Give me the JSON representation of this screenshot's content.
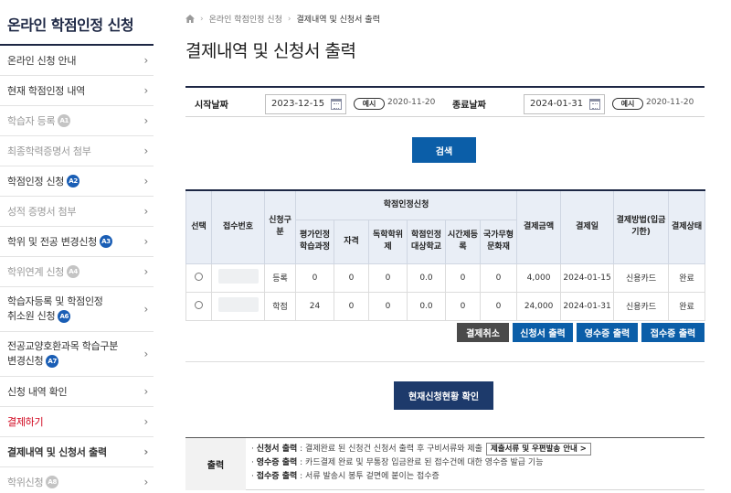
{
  "sidebar": {
    "title": "온라인 학점인정 신청",
    "items": [
      {
        "label": "온라인 신청 안내",
        "badge": ""
      },
      {
        "label": "현재 학점인정 내역",
        "badge": ""
      },
      {
        "label": "학습자 등록",
        "badge": "A1"
      },
      {
        "label": "최종학력증명서 첨부",
        "badge": ""
      },
      {
        "label": "학점인정 신청",
        "badge": "A2"
      },
      {
        "label": "성적 증명서 첨부",
        "badge": ""
      },
      {
        "label": "학위 및 전공 변경신청",
        "badge": "A3"
      },
      {
        "label": "학위연계 신청",
        "badge": "A4"
      },
      {
        "label_line1": "학습자등록 및 학점인정",
        "label_line2": "취소원 신청",
        "badge": "A6"
      },
      {
        "label_line1": "전공교양호환과목 학습구분",
        "label_line2": "변경신청",
        "badge": "A7"
      },
      {
        "label": "신청 내역 확인",
        "badge": ""
      },
      {
        "label": "결제하기",
        "badge": ""
      },
      {
        "label": "결제내역 및 신청서 출력",
        "badge": ""
      },
      {
        "label": "학위신청",
        "badge": "A8"
      }
    ]
  },
  "breadcrumb": {
    "home_icon": "home-icon",
    "level1": "온라인 학점인정 신청",
    "level2": "결제내역 및 신청서 출력"
  },
  "page_title": "결제내역 및 신청서 출력",
  "filter": {
    "start_label": "시작날짜",
    "start_value": "2023-12-15",
    "end_label": "종료날짜",
    "end_value": "2024-01-31",
    "example_label": "예시",
    "example_date": "2020-11-20",
    "search_button": "검색"
  },
  "table": {
    "headers": {
      "select": "선택",
      "receipt_no": "접수번호",
      "app_type": "신청구분",
      "credit_group": "학점인정신청",
      "sub": [
        "평가인정학습과정",
        "자격",
        "독학학위제",
        "학점인정대상학교",
        "시간제등록",
        "국가무형문화재"
      ],
      "amount": "결제금액",
      "pay_date": "결제일",
      "method": "결제방법(입금기한)",
      "status": "결제상태"
    },
    "rows": [
      {
        "type": "등록",
        "sub": [
          "0",
          "0",
          "0",
          "0.0",
          "0",
          "0"
        ],
        "amount": "4,000",
        "date": "2024-01-15",
        "method": "신용카드",
        "status": "완료"
      },
      {
        "type": "학점",
        "sub": [
          "24",
          "0",
          "0",
          "0.0",
          "0",
          "0"
        ],
        "amount": "24,000",
        "date": "2024-01-31",
        "method": "신용카드",
        "status": "완료"
      }
    ]
  },
  "actions": {
    "cancel": "결제취소",
    "print_application": "신청서 출력",
    "print_receipt": "영수증 출력",
    "print_acceptance": "접수증 출력",
    "status_check": "현재신청현황 확인"
  },
  "info": {
    "head": "출력",
    "line1_key": "신청서 출력",
    "line1_text": " : 결제완료 된 신청건 신청서 출력 후 구비서류와 제출",
    "guide_button": "제출서류 및 우편발송 안내 >",
    "line2_key": "영수증 출력",
    "line2_text": " : 카드결제 완료 및 무통장 입금완료 된 접수건에 대한 영수증 발급 기능",
    "line3_key": "접수증 출력",
    "line3_text": " : 서류 발송시 봉투 겉면에 붙이는 접수증"
  },
  "colors": {
    "navy": "#1d2744",
    "blue": "#0b5ea8",
    "active_red": "#d0021b",
    "header_bg": "#e9eef6"
  }
}
